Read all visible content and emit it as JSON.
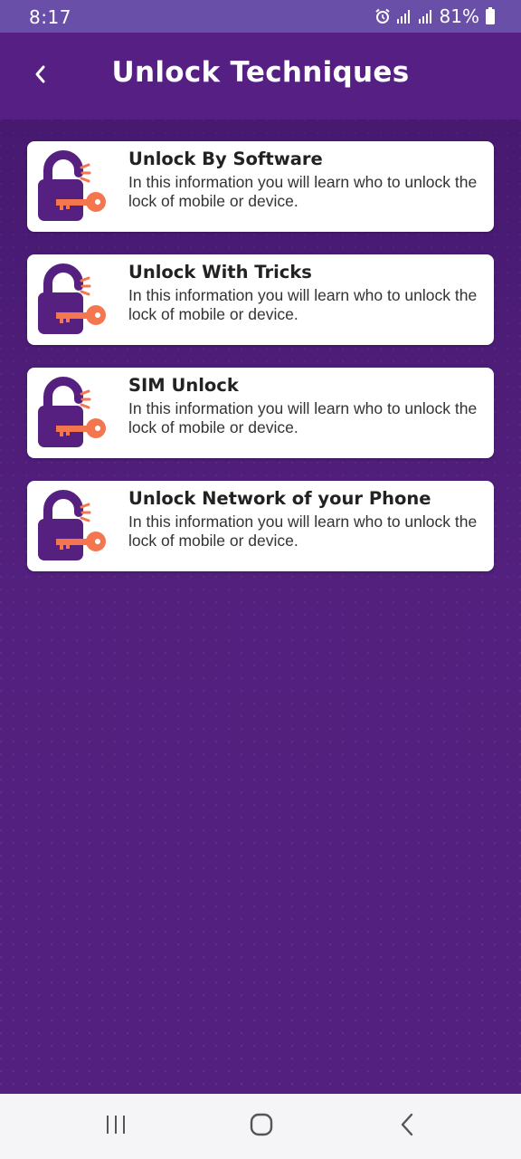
{
  "status_bar": {
    "time": "8:17",
    "battery": "81%",
    "icons": [
      "alarm-icon",
      "signal-icon",
      "signal-icon",
      "battery-icon"
    ]
  },
  "app_bar": {
    "title": "Unlock Techniques",
    "back_icon": "chevron-left-icon"
  },
  "items": [
    {
      "title": "Unlock By Software",
      "description": "In this information you will learn who to unlock the lock of mobile or device.",
      "icon": "padlock-key-icon"
    },
    {
      "title": "Unlock With Tricks",
      "description": "In this information you will learn who to unlock the lock of mobile or device.",
      "icon": "padlock-key-icon"
    },
    {
      "title": "SIM Unlock",
      "description": "In this information you will learn who to unlock the lock of mobile or device.",
      "icon": "padlock-key-icon"
    },
    {
      "title": "Unlock Network of your Phone",
      "description": "In this information you will learn who to unlock the lock of mobile or device.",
      "icon": "padlock-key-icon"
    }
  ],
  "nav_bar": {
    "icons": [
      "recents-icon",
      "home-icon",
      "back-icon"
    ]
  },
  "colors": {
    "status_bar": "#6a4fa8",
    "app_bar": "#561f84",
    "background": "#54207f",
    "lock": "#55207f",
    "key": "#f4764f",
    "card": "#ffffff"
  }
}
